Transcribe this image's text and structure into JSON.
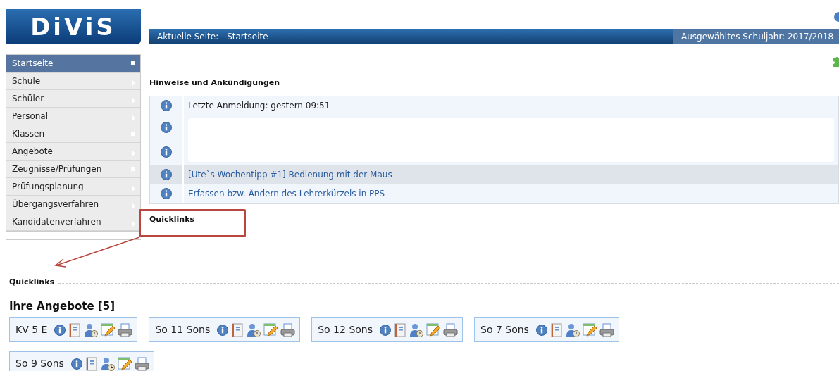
{
  "logo": "DiViS",
  "header": {
    "current_label": "Aktuelle Seite:",
    "current_page": "Startseite",
    "school_year": "Ausgewähltes Schuljahr: 2017/2018"
  },
  "sidebar": {
    "items": [
      {
        "label": "Startseite",
        "selected": true,
        "kind": "page"
      },
      {
        "label": "Schule",
        "selected": false,
        "kind": "submenu"
      },
      {
        "label": "Schüler",
        "selected": false,
        "kind": "submenu"
      },
      {
        "label": "Personal",
        "selected": false,
        "kind": "submenu"
      },
      {
        "label": "Klassen",
        "selected": false,
        "kind": "page"
      },
      {
        "label": "Angebote",
        "selected": false,
        "kind": "submenu"
      },
      {
        "label": "Zeugnisse/Prüfungen",
        "selected": false,
        "kind": "page"
      },
      {
        "label": "Prüfungsplanung",
        "selected": false,
        "kind": "submenu"
      },
      {
        "label": "Übergangsverfahren",
        "selected": false,
        "kind": "submenu"
      },
      {
        "label": "Kandidatenverfahren",
        "selected": false,
        "kind": "submenu"
      }
    ]
  },
  "notices": {
    "title": "Hinweise und Ankündigungen",
    "rows": [
      {
        "kind": "text",
        "text": "Letzte Anmeldung: gestern 09:51",
        "highlighted": false
      },
      {
        "kind": "blank",
        "highlighted": false
      },
      {
        "kind": "link",
        "text": "[Ute`s Wochentipp #1] Bedienung mit der Maus",
        "highlighted": true
      },
      {
        "kind": "link",
        "text": "Erfassen bzw. Ändern des Lehrerkürzels in PPS",
        "highlighted": false
      }
    ]
  },
  "quicklinks_inline": {
    "title": "Quicklinks"
  },
  "quicklinks": {
    "title": "Quicklinks",
    "subtitle": "Ihre Angebote [5]",
    "offers": [
      {
        "label": "KV 5 E"
      },
      {
        "label": "So 11 Sons"
      },
      {
        "label": "So 12 Sons"
      },
      {
        "label": "So 7 Sons"
      },
      {
        "label": "So 9 Sons"
      }
    ]
  }
}
